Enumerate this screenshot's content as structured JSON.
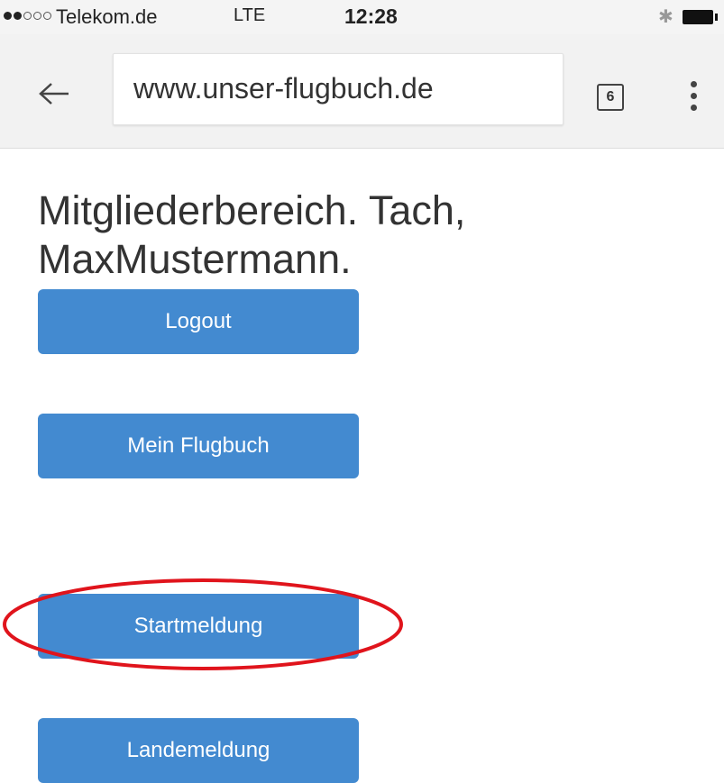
{
  "status_bar": {
    "carrier": "Telekom.de",
    "network": "LTE",
    "time": "12:28",
    "signal_bars_filled": 2,
    "signal_bars_total": 5,
    "bluetooth_icon": "bluetooth-icon",
    "battery_icon": "battery-icon"
  },
  "browser": {
    "url": "www.unser-flugbuch.de",
    "tab_count": "6",
    "back_icon": "arrow-left-icon",
    "menu_icon": "more-vert-icon"
  },
  "page": {
    "title": "Mitgliederbereich. Tach, MaxMustermann.",
    "buttons": {
      "logout": "Logout",
      "mein_flugbuch": "Mein Flugbuch",
      "startmeldung": "Startmeldung",
      "landemeldung": "Landemeldung"
    },
    "button_color": "#438ad0",
    "highlight_color": "#e0141c"
  }
}
